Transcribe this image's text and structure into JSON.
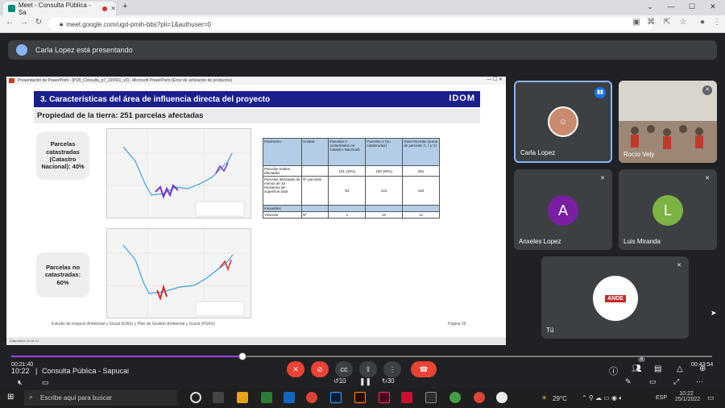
{
  "browser": {
    "tab_title": "Meet - Consulta Pública - Sa",
    "url": "meet.google.com/ugd-pmih-bbs?pli=1&authuser=0"
  },
  "banner": {
    "text": "Carla Lopez está presentando"
  },
  "ppt": {
    "window_title": "Presentación de PowerPoint - [P1B_Consulta_p7_220411_v2] - Microsoft PowerPoint (Error de activación de productos)",
    "status": "Diapositiva 25 de 41"
  },
  "slide": {
    "title": "3. Características del área de influencia directa del proyecto",
    "brand": "IDOM",
    "subtitle": "Propiedad de la tierra: 251 parcelas afectadas",
    "bubble_top": "Parcelas catastradas (Catastro Nacional): 40%",
    "bubble_bottom": "Parcelas no catastradas: 60%",
    "table": {
      "headers": [
        "Parámetro",
        "Unidad",
        "Parcelas C (catastrados en Catastro Nacional)",
        "Parcelas V (no catastradas)",
        "Total Parcelas (suma de parcelas C, I y V)"
      ],
      "rows": [
        [
          "Parcelas totales afectadas",
          "",
          "101 (40%)",
          "150 (60%)",
          "251"
        ],
        [
          "Parcelas afectadas de menos de 10 hectáreas de superficie total",
          "Nº parcelas",
          "63",
          "101",
          "164"
        ],
        [
          "Inmuebles",
          "",
          "",
          "",
          ""
        ],
        [
          "Vivienda",
          "Nº",
          "2",
          "10",
          "12"
        ]
      ]
    },
    "footer": "Estudio de Impacto Ambiental y Social (EIAS) y Plan de Gestión Ambiental y Social (PGAS)",
    "page": "Página 25"
  },
  "participants": [
    {
      "name": "Carla Lopez",
      "speaking": true
    },
    {
      "name": "Rocío Vely",
      "muted": true
    },
    {
      "name": "Anxeles Lopez",
      "initial": "A",
      "color": "#7b1fa2",
      "muted": true
    },
    {
      "name": "Luis Miranda",
      "initial": "L",
      "color": "#7cb342",
      "muted": true
    },
    {
      "name": "Tú",
      "logo": "ANDE",
      "muted": true
    }
  ],
  "player": {
    "elapsed": "00:21:40",
    "remaining": "00:43:54",
    "progress": 0.33,
    "clock": "10:22",
    "meeting_name": "Consulta Pública - Sapucai",
    "skip_back": "10",
    "skip_fwd": "30",
    "people_count": "6"
  },
  "taskbar": {
    "search_placeholder": "Escribe aquí para buscar",
    "weather": "29°C",
    "lang": "ESP",
    "time": "10:22",
    "date": "25/1/2022"
  }
}
